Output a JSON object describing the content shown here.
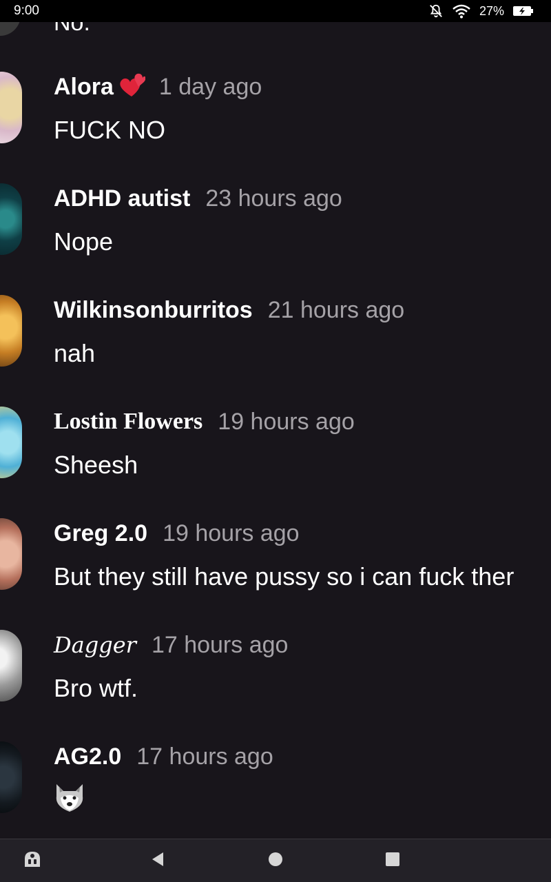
{
  "status_bar": {
    "time": "9:00",
    "battery_percent": "27%",
    "icons": [
      "notifications-muted-icon",
      "wifi-icon",
      "battery-charging-icon"
    ]
  },
  "top_partial_comment": {
    "text": "No."
  },
  "comments": [
    {
      "author": "Alora",
      "author_badge": "two-hearts-emoji",
      "time": "1 day ago",
      "text": "FUCK NO"
    },
    {
      "author": "ADHD autist",
      "time": "23 hours ago",
      "text": "Nope"
    },
    {
      "author": "Wilkinsonburritos",
      "time": "21 hours ago",
      "text": "nah"
    },
    {
      "author": "Lostin Flowers",
      "time": "19 hours ago",
      "text": "Sheesh"
    },
    {
      "author": "Greg 2.0",
      "time": "19 hours ago",
      "text": "But they still have pussy so i can fuck ther"
    },
    {
      "author": "Dagger",
      "time": "17 hours ago",
      "text": "Bro wtf."
    },
    {
      "author": "AG2.0",
      "time": "17 hours ago",
      "text": "",
      "emoji": "wolf-emoji"
    }
  ],
  "nav_bar": {
    "buttons": [
      "assistant-icon",
      "back-icon",
      "home-icon",
      "recents-icon"
    ]
  },
  "colors": {
    "background": "#18151b",
    "status_bar": "#000000",
    "nav_bar": "#232127",
    "text_primary": "#ffffff",
    "text_secondary": "#a5a2a7"
  }
}
